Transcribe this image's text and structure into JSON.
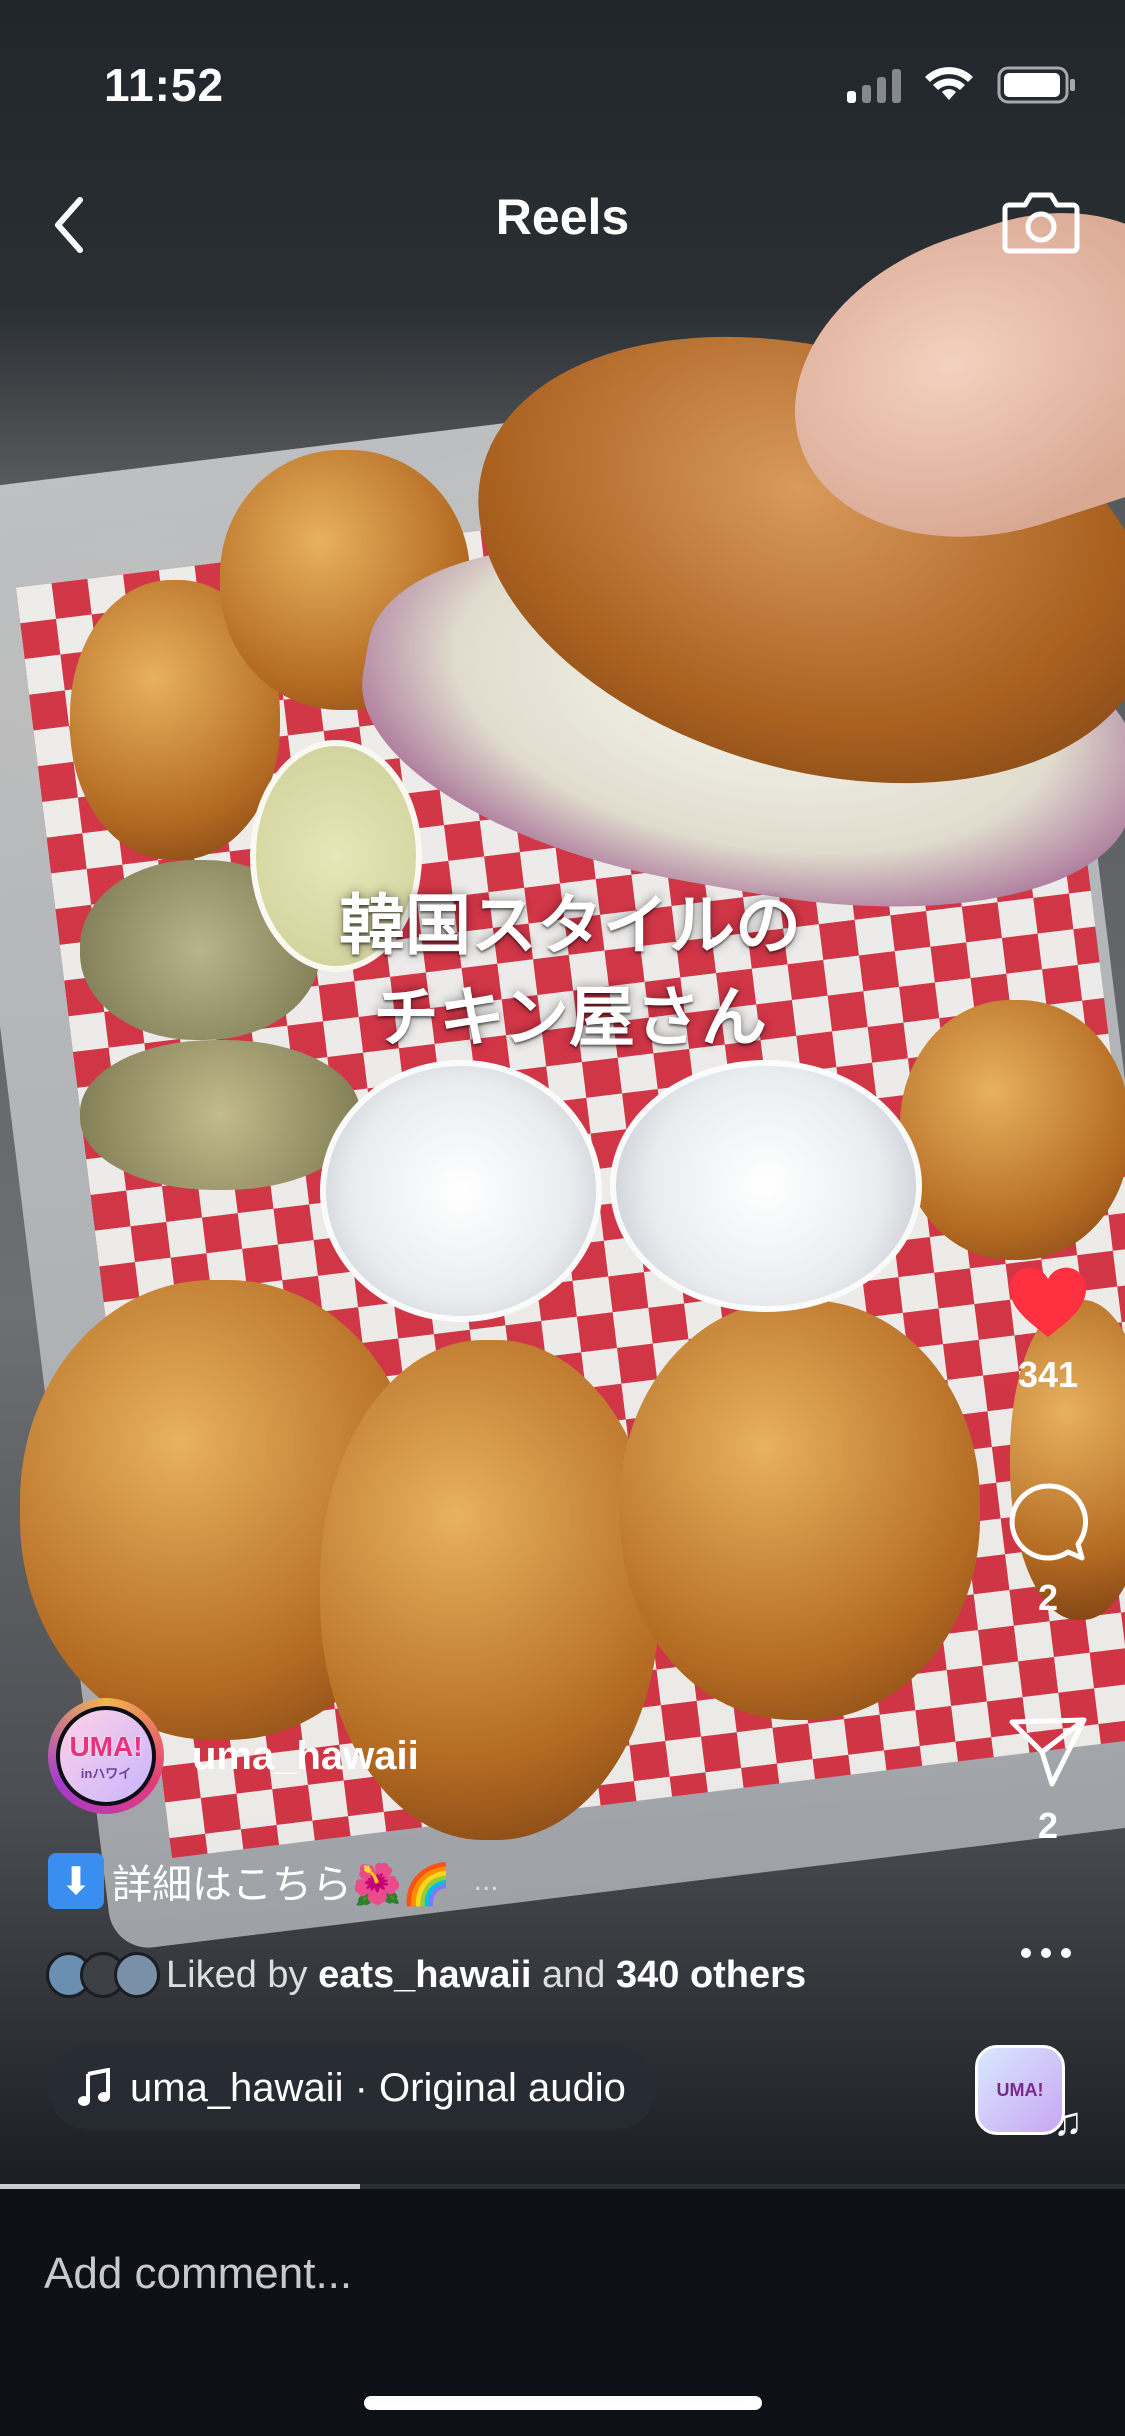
{
  "status_bar": {
    "time": "11:52",
    "signal_icon": "cellular-signal-icon",
    "wifi_icon": "wifi-icon",
    "battery_icon": "battery-icon"
  },
  "header": {
    "title": "Reels",
    "back_icon": "chevron-left-icon",
    "camera_icon": "camera-icon"
  },
  "video": {
    "overlay_text_line1": "韓国スタイルの",
    "overlay_text_line2": "チキン屋さん"
  },
  "actions": {
    "like": {
      "icon": "heart-filled-icon",
      "count": "341",
      "color": "#ff3040"
    },
    "comment": {
      "icon": "comment-bubble-icon",
      "count": "2"
    },
    "share": {
      "icon": "paper-plane-icon",
      "count": "2"
    },
    "more_icon": "more-dots-icon"
  },
  "post": {
    "username": "uma_hawaii",
    "avatar_text_big": "UMA!",
    "avatar_text_small": "inハワイ",
    "caption": "詳細はこちら🌺🌈",
    "caption_more": "...",
    "liked_prefix": "Liked by",
    "liked_user": "eats_hawaii",
    "liked_and": "and",
    "liked_others": "340 others"
  },
  "audio": {
    "label": "uma_hawaii · Original audio",
    "icon": "music-note-icon",
    "thumb_text": "UMA\nin"
  },
  "progress": {
    "fraction": 0.32
  },
  "comment": {
    "placeholder": "Add comment..."
  }
}
